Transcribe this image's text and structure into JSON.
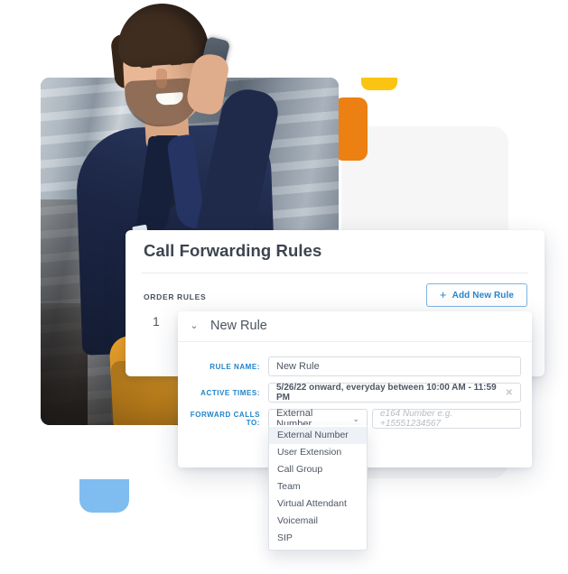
{
  "colors": {
    "accent_blue": "#2183c9",
    "link_blue": "#2785cc",
    "yellow_shape": "#FBC412",
    "orange_shape": "#EC8013",
    "blue_shape": "#7FBDF0",
    "grey_panel": "#F6F6F6",
    "text_dark": "#4b5360",
    "dropdown_highlight": "#eef1f6"
  },
  "photo": {
    "alt": "Smiling man in navy blazer talking on a mobile phone"
  },
  "card": {
    "title": "Call Forwarding Rules",
    "columns": {
      "order": "ORDER",
      "rules": "RULES"
    },
    "rows": [
      {
        "order": "1"
      }
    ],
    "add_button": {
      "label": "Add New Rule",
      "icon": "+"
    }
  },
  "panel": {
    "title": "New Rule",
    "chevron": "⌄",
    "fields": {
      "rule_name": {
        "label": "RULE NAME:",
        "value": "New Rule",
        "placeholder": "New Rule"
      },
      "active_times": {
        "label": "ACTIVE TIMES:",
        "value": "5/26/22 onward, everyday between 10:00 AM - 11:59 PM",
        "clear_icon": "✕"
      },
      "forward_calls_to": {
        "label": "FORWARD CALLS TO:",
        "selected": "External Number",
        "chevron": "⌄",
        "number_placeholder": "e164 Number e.g. +15551234567",
        "number_value": ""
      }
    }
  },
  "dropdown": {
    "options": [
      {
        "label": "External Number",
        "selected": true
      },
      {
        "label": "User Extension",
        "selected": false
      },
      {
        "label": "Call Group",
        "selected": false
      },
      {
        "label": "Team",
        "selected": false
      },
      {
        "label": "Virtual Attendant",
        "selected": false
      },
      {
        "label": "Voicemail",
        "selected": false
      },
      {
        "label": "SIP",
        "selected": false
      }
    ]
  }
}
